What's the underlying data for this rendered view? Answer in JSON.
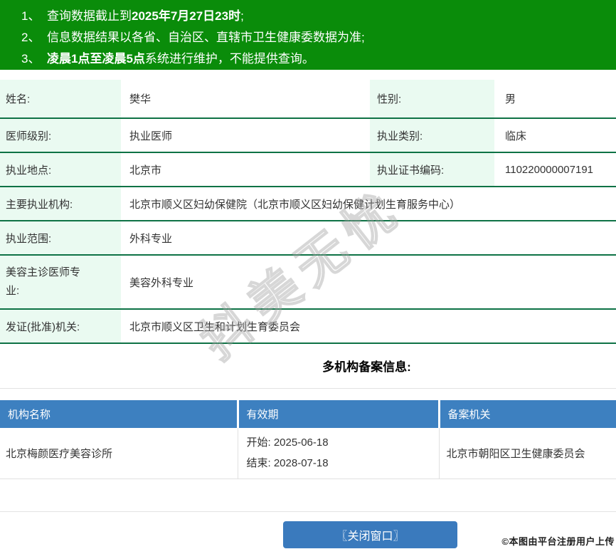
{
  "banner": {
    "items": [
      {
        "num": "1、",
        "pre": "查询数据截止到",
        "bold": "2025年7月27日23时",
        "post": ";"
      },
      {
        "num": "2、",
        "pre": "信息数据结果以各省、自治区、直辖市卫生健康委数据为准;",
        "bold": "",
        "post": ""
      },
      {
        "num": "3、",
        "pre": "",
        "bold": "凌晨1点至凌晨5点",
        "post": "系统进行维护，不能提供查询。"
      }
    ]
  },
  "doctor_info": {
    "name_label": "姓名:",
    "name_value": "樊华",
    "gender_label": "性别:",
    "gender_value": "男",
    "level_label": "医师级别:",
    "level_value": "执业医师",
    "category_label": "执业类别:",
    "category_value": "临床",
    "place_label": "执业地点:",
    "place_value": "北京市",
    "cert_label": "执业证书编码:",
    "cert_value": "110220000007191",
    "main_org_label": "主要执业机构:",
    "main_org_value": "北京市顺义区妇幼保健院（北京市顺义区妇幼保健计划生育服务中心）",
    "scope_label": "执业范围:",
    "scope_value": "外科专业",
    "beauty_label": "美容主诊医师专业:",
    "beauty_value": "美容外科专业",
    "issuer_label": "发证(批准)机关:",
    "issuer_value": "北京市顺义区卫生和计划生育委员会"
  },
  "filing": {
    "section_title": "多机构备案信息:",
    "headers": [
      "机构名称",
      "有效期",
      "备案机关"
    ],
    "rows": [
      {
        "org": "北京梅颜医疗美容诊所",
        "start": "开始: 2025-06-18",
        "end": "结束: 2028-07-18",
        "authority": "北京市朝阳区卫生健康委员会"
      }
    ]
  },
  "footer": {
    "close_button": "〖关闭窗口〗",
    "credit": "©本图由平台注册用户上传"
  },
  "watermark": "抖美无忧",
  "colors": {
    "banner_green": "#0a8c0a",
    "label_cell_bg": "#eafaf1",
    "row_border_green": "#0e7245",
    "table_header_blue": "#3d80c0",
    "button_blue": "#3a7abd"
  }
}
